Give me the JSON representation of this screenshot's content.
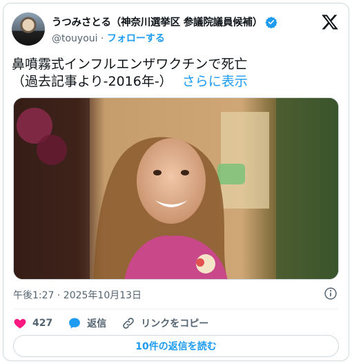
{
  "author": {
    "display_name": "うつみさとる（神奈川選挙区 参議院議員候補）",
    "handle": "@touyoui",
    "separator": "·",
    "follow_label": "フォローする"
  },
  "tweet": {
    "line1": "鼻噴霧式インフルエンザワクチンで死亡",
    "line2": "（過去記事より-2016年-）",
    "show_more": "さらに表示"
  },
  "meta": {
    "timestamp": "午後1:27 · 2025年10月13日"
  },
  "actions": {
    "like_count": "427",
    "reply_label": "返信",
    "copy_link_label": "リンクをコピー"
  },
  "read_replies_label": "10件の返信を読む",
  "colors": {
    "accent": "#1d9bf0",
    "like": "#f91880",
    "text_secondary": "#536471",
    "border": "#cfd9de"
  },
  "icons": {
    "verified": "verified-badge-icon",
    "logo": "x-logo-icon",
    "info": "info-icon",
    "like": "heart-icon",
    "reply": "reply-bubble-icon",
    "link": "link-icon"
  }
}
